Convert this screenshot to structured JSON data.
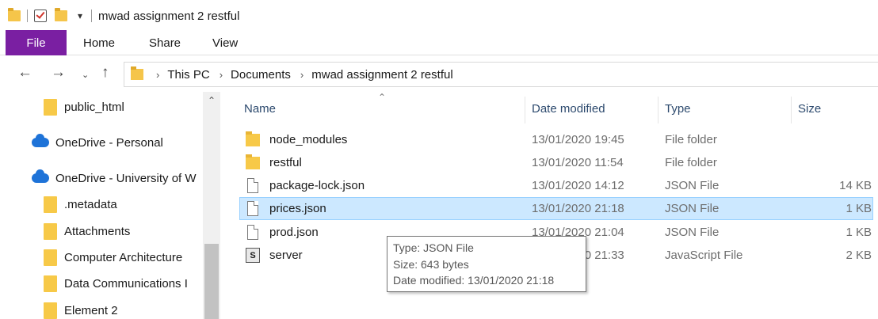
{
  "window": {
    "title": "mwad assignment 2 restful"
  },
  "ribbon": {
    "tabs": [
      {
        "label": "File"
      },
      {
        "label": "Home"
      },
      {
        "label": "Share"
      },
      {
        "label": "View"
      }
    ]
  },
  "address": {
    "crumbs": [
      "This PC",
      "Documents",
      "mwad assignment 2 restful"
    ]
  },
  "navpane": {
    "items": [
      {
        "label": "public_html",
        "icon": "folder-icon"
      },
      {
        "label": "OneDrive - Personal",
        "icon": "onedrive-cloud-icon"
      },
      {
        "label": "OneDrive - University of W",
        "icon": "onedrive-cloud-icon"
      },
      {
        "label": ".metadata",
        "icon": "folder-icon"
      },
      {
        "label": "Attachments",
        "icon": "folder-icon"
      },
      {
        "label": "Computer Architecture",
        "icon": "folder-icon"
      },
      {
        "label": "Data Communications I",
        "icon": "folder-icon"
      },
      {
        "label": "Element 2",
        "icon": "folder-icon"
      }
    ]
  },
  "columns": {
    "name": "Name",
    "date": "Date modified",
    "type": "Type",
    "size": "Size"
  },
  "files": [
    {
      "name": "node_modules",
      "date": "13/01/2020 19:45",
      "type": "File folder",
      "size": "",
      "icon": "folder-icon"
    },
    {
      "name": "restful",
      "date": "13/01/2020 11:54",
      "type": "File folder",
      "size": "",
      "icon": "folder-icon"
    },
    {
      "name": "package-lock.json",
      "date": "13/01/2020 14:12",
      "type": "JSON File",
      "size": "14 KB",
      "icon": "file-icon"
    },
    {
      "name": "prices.json",
      "date": "13/01/2020 21:18",
      "type": "JSON File",
      "size": "1 KB",
      "icon": "file-icon"
    },
    {
      "name": "prod.json",
      "date": "13/01/2020 21:04",
      "type": "JSON File",
      "size": "1 KB",
      "icon": "file-icon"
    },
    {
      "name": "server",
      "date": "13/01/2020 21:33",
      "type": "JavaScript File",
      "size": "2 KB",
      "icon": "javascript-file-icon"
    }
  ],
  "tooltip": {
    "type": "Type: JSON File",
    "size": "Size: 643 bytes",
    "date": "Date modified: 13/01/2020 21:18"
  },
  "colors": {
    "file_tab": "#7a1fa2",
    "selection": "#cce8ff",
    "folder": "#f7c948",
    "onedrive": "#1e73d8"
  }
}
